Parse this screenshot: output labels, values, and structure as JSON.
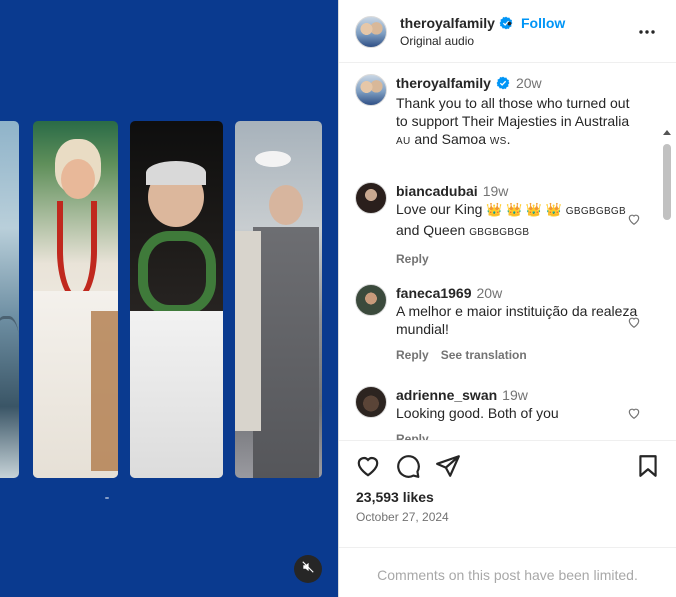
{
  "header": {
    "username": "theroyalfamily",
    "separator": "•",
    "follow_label": "Follow",
    "audio_label": "Original audio"
  },
  "caption": {
    "username": "theroyalfamily",
    "time": "20w",
    "text": "Thank you to all those who turned out to support Their Majesties in Australia",
    "flag1": "AU",
    "mid": "and Samoa",
    "flag2": "WS",
    "end": "."
  },
  "comments": [
    {
      "username": "biancadubai",
      "time": "19w",
      "text_start": "Love our King",
      "crowns": "👑 👑 👑 👑",
      "flag_a": "GBGBGBGB",
      "text_mid": "and Queen",
      "flag_b": "GBGBGBGB",
      "reply_label": "Reply"
    },
    {
      "username": "faneca1969",
      "time": "20w",
      "text": "A melhor e maior instituição da realeza mundial!",
      "reply_label": "Reply",
      "translate_label": "See translation"
    },
    {
      "username": "adrienne_swan",
      "time": "19w",
      "text": "Looking good. Both of you",
      "reply_label": "Reply"
    }
  ],
  "icons": {
    "like": "heart-icon",
    "comment": "comment-icon",
    "share": "share-icon",
    "save": "bookmark-icon",
    "more": "more-horizontal-icon",
    "mute": "audio-muted-icon",
    "verified": "verified-badge-icon"
  },
  "post": {
    "likes": "23,593 likes",
    "date": "October 27, 2024",
    "comments_limited": "Comments on this post have been limited."
  },
  "colors": {
    "media_background": "#0a3a8f",
    "follow_blue": "#0095f6",
    "verified_blue": "#0095f6",
    "secondary_text": "#737373"
  }
}
